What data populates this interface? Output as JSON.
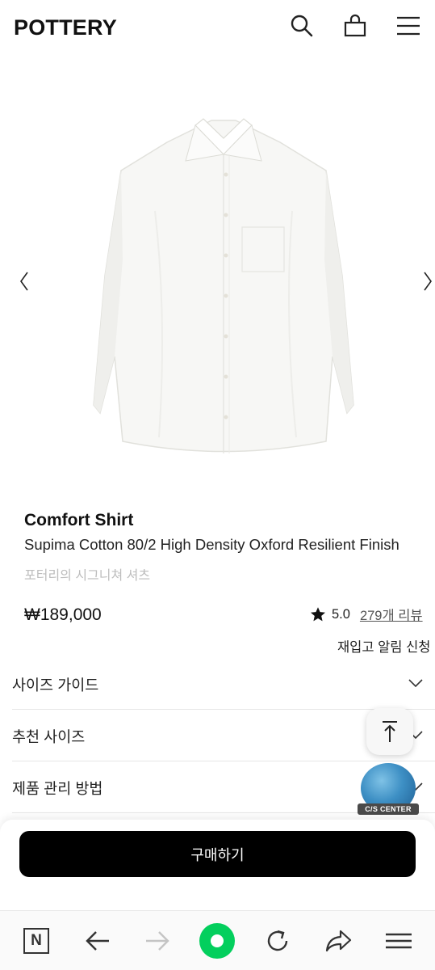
{
  "header": {
    "logo": "POTTERY",
    "icons": [
      "search-icon",
      "shopping-bag-icon",
      "hamburger-menu-icon"
    ]
  },
  "gallery": {
    "prev_icon": "chevron-left-icon",
    "next_icon": "chevron-right-icon",
    "image": "white-oxford-shirt"
  },
  "product": {
    "name": "Comfort Shirt",
    "subtitle": "Supima Cotton 80/2 High Density Oxford Resilient Finish",
    "description": "포터리의 시그니쳐 셔츠",
    "price": "₩189,000",
    "rating": "5.0",
    "reviews": "279개 리뷰",
    "restock": "재입고 알림 신청"
  },
  "accordion": [
    {
      "label": "사이즈 가이드"
    },
    {
      "label": "추천 사이즈"
    },
    {
      "label": "제품 관리 방법"
    }
  ],
  "floating": {
    "cs_label": "C/S CENTER"
  },
  "purchase": {
    "buy_label": "구매하기"
  },
  "browser": {
    "n_label": "N",
    "icons": [
      "naver-n-icon",
      "back-arrow-icon",
      "forward-arrow-icon",
      "green-home-icon",
      "reload-icon",
      "share-icon",
      "menu-icon"
    ]
  },
  "colors": {
    "buy_button": "#000000",
    "naver_green": "#03cf5d",
    "desc_text": "#bdbdbd"
  }
}
